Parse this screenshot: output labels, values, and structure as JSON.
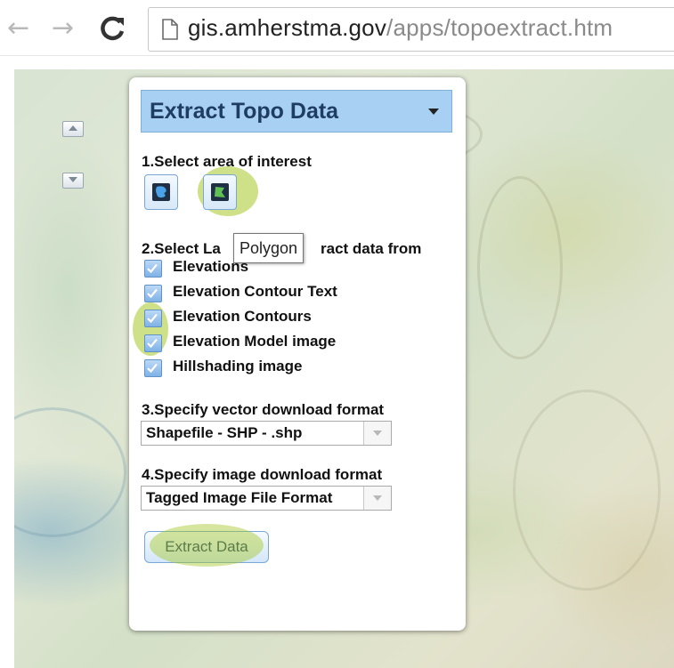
{
  "browser": {
    "back_icon": "back-arrow-icon",
    "forward_icon": "forward-arrow-icon",
    "reload_icon": "reload-icon",
    "page_icon": "page-icon",
    "url_host": "gis.amherstma.gov",
    "url_path": "/apps/topoextract.htm"
  },
  "map": {
    "zoom_in_icon": "chevron-up-icon",
    "zoom_out_icon": "chevron-down-icon"
  },
  "panel": {
    "title": "Extract Topo Data",
    "step1_label": "1.Select area of interest",
    "tools": [
      {
        "name": "freehand-tool",
        "icon": "freehand-select-icon"
      },
      {
        "name": "polygon-tool",
        "icon": "polygon-select-icon"
      }
    ],
    "tooltip": "Polygon",
    "step2_label": "2.Select La",
    "step2_label_tail": "ract data from",
    "layers": [
      {
        "label": "Elevations",
        "checked": true
      },
      {
        "label": "Elevation Contour Text",
        "checked": true
      },
      {
        "label": "Elevation Contours",
        "checked": true
      },
      {
        "label": "Elevation Model image",
        "checked": true
      },
      {
        "label": "Hillshading image",
        "checked": true
      }
    ],
    "step3_label": "3.Specify vector download format",
    "vector_format": "Shapefile - SHP - .shp",
    "step4_label": "4.Specify image download format",
    "image_format": "Tagged Image File Format",
    "extract_button": "Extract Data"
  },
  "colors": {
    "header_bg": "#a8d0f3",
    "title": "#1f3d63",
    "highlight": "#a5c828"
  }
}
